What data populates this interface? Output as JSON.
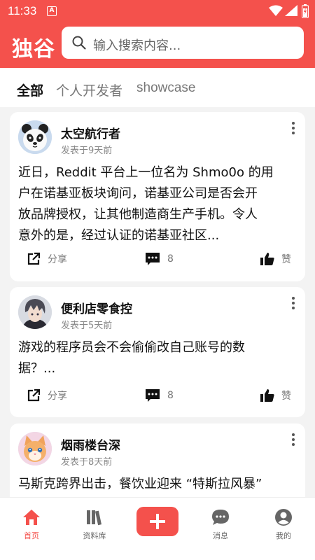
{
  "status": {
    "time": "11:33"
  },
  "header": {
    "app_title": "独谷",
    "search_placeholder": "输入搜索内容..."
  },
  "tabs": [
    {
      "label": "全部",
      "active": true
    },
    {
      "label": "个人开发者",
      "active": false
    },
    {
      "label": "showcase",
      "active": false
    }
  ],
  "posts": [
    {
      "author": "太空航行者",
      "date": "发表于9天前",
      "lines": [
        "近日，Reddit 平台上一位名为 Shmo0o 的用",
        "户在诺基亚板块询问，诺基亚公司是否会开",
        "放品牌授权，让其他制造商生产手机。令人",
        "意外的是，经过认证的诺基亚社区..."
      ],
      "share_label": "分享",
      "comments": "8",
      "like_label": "赞",
      "avatar": "panda-avatar"
    },
    {
      "author": "便利店零食控",
      "date": "发表于5天前",
      "lines": [
        "游戏的程序员会不会偷偷改自己账号的数",
        "据？..."
      ],
      "share_label": "分享",
      "comments": "8",
      "like_label": "赞",
      "avatar": "anime-boy-avatar"
    },
    {
      "author": "烟雨楼台深",
      "date": "发表于8天前",
      "lines": [
        "马斯克跨界出击，餐饮业迎来 “特斯拉风暴”"
      ],
      "avatar": "pixel-cat-avatar"
    }
  ],
  "bottom_nav": [
    {
      "label": "首页",
      "icon": "home-icon",
      "active": true
    },
    {
      "label": "资料库",
      "icon": "library-icon",
      "active": false
    },
    {
      "label": "",
      "icon": "plus-icon",
      "active": false
    },
    {
      "label": "消息",
      "icon": "message-icon",
      "active": false
    },
    {
      "label": "我的",
      "icon": "profile-icon",
      "active": false
    }
  ],
  "colors": {
    "brand": "#f4514c",
    "background": "#f3f3f3"
  }
}
